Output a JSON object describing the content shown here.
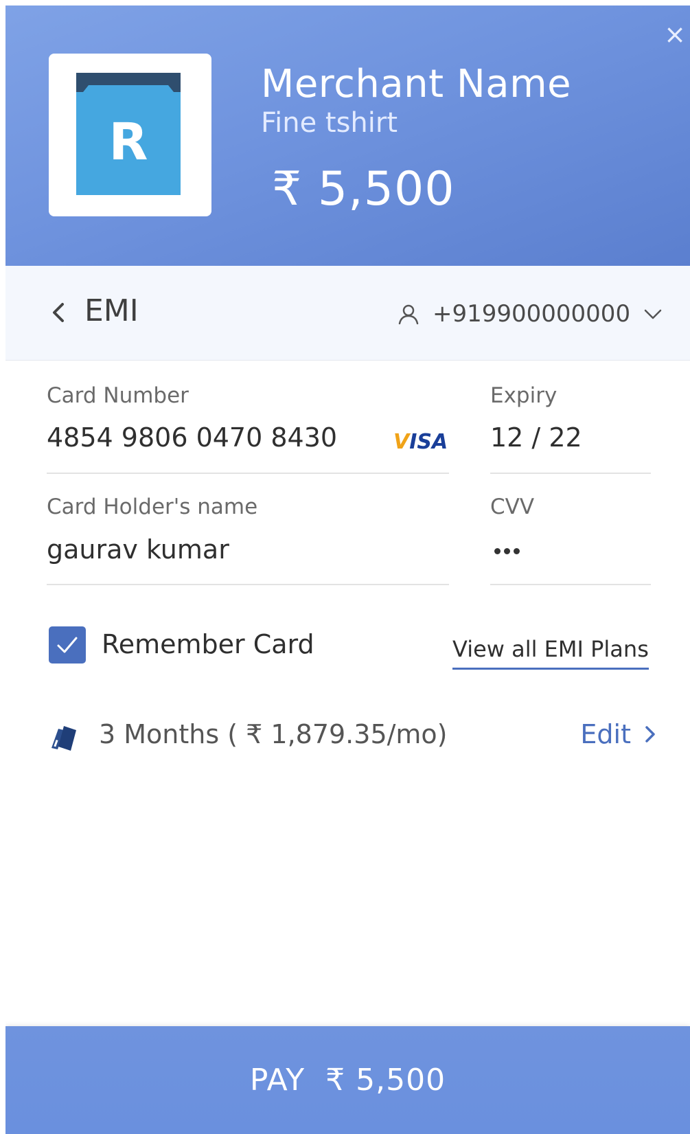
{
  "header": {
    "merchant_name": "Merchant Name",
    "item": "Fine tshirt",
    "amount": "₹ 5,500",
    "logo_letter": "R",
    "close_icon": "×"
  },
  "nav": {
    "title": "EMI",
    "contact": "+919900000000"
  },
  "form": {
    "card_number_label": "Card Number",
    "card_number": "4854 9806 0470 8430",
    "card_brand": "VISA",
    "expiry_label": "Expiry",
    "expiry": "12 / 22",
    "holder_label": "Card Holder's name",
    "holder": "gaurav kumar",
    "cvv_label": "CVV",
    "remember_label": "Remember Card",
    "remember_checked": true,
    "view_plans": "View all EMI Plans"
  },
  "plan": {
    "text": "3 Months ( ₹ 1,879.35/mo)",
    "edit": "Edit"
  },
  "footer": {
    "pay_label": "PAY  ₹ 5,500"
  },
  "colors": {
    "accent": "#4a6fbe",
    "header_bg": "#6f93de",
    "logo_blue": "#45a7e0",
    "logo_dark": "#2f4e6e"
  }
}
